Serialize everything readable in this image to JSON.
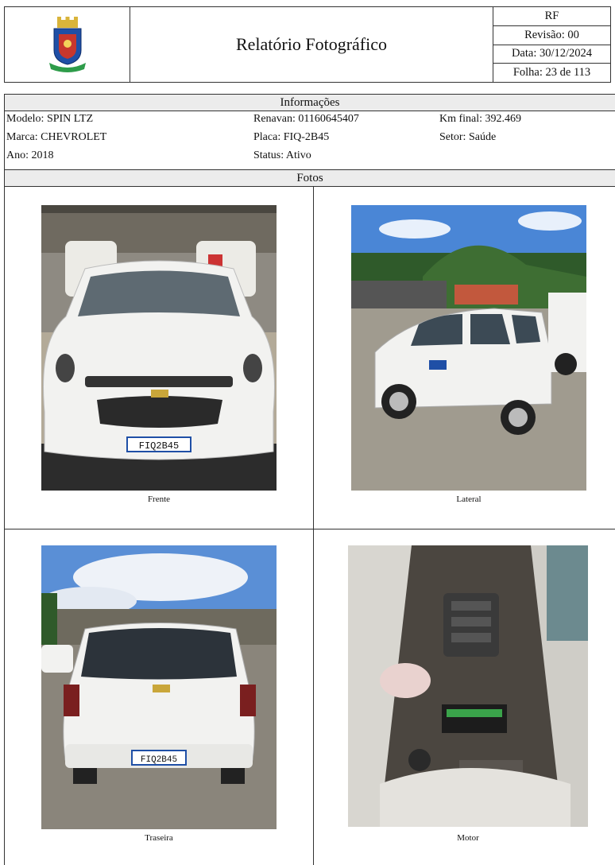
{
  "header": {
    "logo_icon": "municipal-coat-of-arms-icon",
    "title": "Relatório Fotográfico",
    "code": "RF",
    "revision": "Revisão: 00",
    "date": "Data: 30/12/2024",
    "sheet": "Folha: 23 de 113"
  },
  "info": {
    "section_title": "Informações",
    "modelo": "Modelo: SPIN LTZ",
    "marca": "Marca: CHEVROLET",
    "ano": "Ano: 2018",
    "renavan": "Renavan: 01160645407",
    "placa": "Placa: FIQ-2B45",
    "status": "Status: Ativo",
    "km_final": "Km final: 392.469",
    "setor": "Setor: Saúde"
  },
  "photos": {
    "section_title": "Fotos",
    "items": [
      {
        "caption": "Frente",
        "plate_text": "FIQ2B45"
      },
      {
        "caption": "Lateral"
      },
      {
        "caption": "Traseira",
        "plate_text": "FIQ2B45"
      },
      {
        "caption": "Motor"
      }
    ]
  },
  "colors": {
    "border": "#333333",
    "band": "#ececec",
    "sky": "#4a86d6",
    "car_white": "#f2f2f0"
  }
}
